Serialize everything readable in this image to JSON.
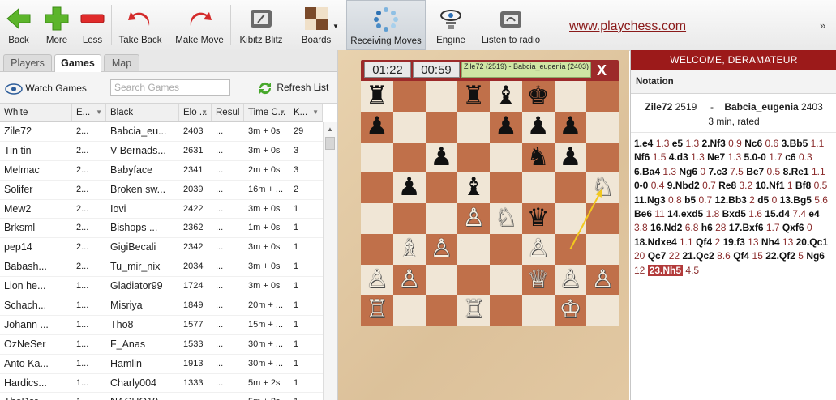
{
  "toolbar": {
    "back": "Back",
    "more": "More",
    "less": "Less",
    "take_back": "Take Back",
    "make_move": "Make Move",
    "kibitz_blitz": "Kibitz Blitz",
    "boards": "Boards",
    "receiving_moves": "Receiving Moves",
    "engine": "Engine",
    "listen_radio": "Listen to radio",
    "site_link": "www.playchess.com",
    "more_chevron": "»"
  },
  "tabs": [
    "Players",
    "Games",
    "Map"
  ],
  "active_tab": "Games",
  "subbar": {
    "watch_games": "Watch Games",
    "search_placeholder": "Search Games",
    "refresh_list": "Refresh List"
  },
  "columns": [
    "White",
    "E...",
    "Black",
    "Elo ...",
    "Resul",
    "Time C...",
    "K..."
  ],
  "games": [
    [
      "Zile72",
      "2...",
      "Babcia_eu...",
      "2403",
      "...",
      "3m + 0s",
      "29"
    ],
    [
      "Tin tin",
      "2...",
      "V-Bernads...",
      "2631",
      "...",
      "3m + 0s",
      "3"
    ],
    [
      "Melmac",
      "2...",
      "Babyface",
      "2341",
      "...",
      "2m + 0s",
      "3"
    ],
    [
      "Solifer",
      "2...",
      "Broken sw...",
      "2039",
      "...",
      "16m + ...",
      "2"
    ],
    [
      "Mew2",
      "2...",
      "Iovi",
      "2422",
      "...",
      "3m + 0s",
      "1"
    ],
    [
      "Brksml",
      "2...",
      "Bishops ...",
      "2362",
      "...",
      "1m + 0s",
      "1"
    ],
    [
      "pep14",
      "2...",
      "GigiBecali",
      "2342",
      "...",
      "3m + 0s",
      "1"
    ],
    [
      "Babash...",
      "2...",
      "Tu_mir_nix",
      "2034",
      "...",
      "3m + 0s",
      "1"
    ],
    [
      "Lion he...",
      "1...",
      "Gladiator99",
      "1724",
      "...",
      "3m + 0s",
      "1"
    ],
    [
      "Schach...",
      "1...",
      "Misriya",
      "1849",
      "...",
      "20m + ...",
      "1"
    ],
    [
      "Johann ...",
      "1...",
      "Tho8",
      "1577",
      "...",
      "15m + ...",
      "1"
    ],
    [
      "OzNeSer",
      "1...",
      "F_Anas",
      "1533",
      "...",
      "30m + ...",
      "1"
    ],
    [
      "Anto Ka...",
      "1...",
      "Hamlin",
      "1913",
      "...",
      "30m + ...",
      "1"
    ],
    [
      "Hardics...",
      "1...",
      "Charly004",
      "1333",
      "...",
      "5m + 2s",
      "1"
    ],
    [
      "TheDar...",
      "1...",
      "NACHO19...",
      "",
      "...",
      "5m + 2s",
      "1"
    ]
  ],
  "board": {
    "clock_left": "01:22",
    "clock_right": "00:59",
    "players": "Zile72 (2519) - Babcia_eugenia (2403)",
    "close": "X",
    "pieces": [
      {
        "sq": "a8",
        "p": "♜",
        "c": "b"
      },
      {
        "sq": "d8",
        "p": "♜",
        "c": "b"
      },
      {
        "sq": "e8",
        "p": "♝",
        "c": "b"
      },
      {
        "sq": "f8",
        "p": "♚",
        "c": "b"
      },
      {
        "sq": "a7",
        "p": "♟",
        "c": "b"
      },
      {
        "sq": "e7",
        "p": "♟",
        "c": "b"
      },
      {
        "sq": "f7",
        "p": "♟",
        "c": "b"
      },
      {
        "sq": "g7",
        "p": "♟",
        "c": "b"
      },
      {
        "sq": "c6",
        "p": "♟",
        "c": "b"
      },
      {
        "sq": "f6",
        "p": "♞",
        "c": "b"
      },
      {
        "sq": "g6",
        "p": "♟",
        "c": "b"
      },
      {
        "sq": "b5",
        "p": "♟",
        "c": "b"
      },
      {
        "sq": "d5",
        "p": "♝",
        "c": "b"
      },
      {
        "sq": "h5",
        "p": "♘",
        "c": "w"
      },
      {
        "sq": "d4",
        "p": "♙",
        "c": "w"
      },
      {
        "sq": "e4",
        "p": "♘",
        "c": "w"
      },
      {
        "sq": "f4",
        "p": "♛",
        "c": "b"
      },
      {
        "sq": "b3",
        "p": "♗",
        "c": "w"
      },
      {
        "sq": "c3",
        "p": "♙",
        "c": "w"
      },
      {
        "sq": "f3",
        "p": "♙",
        "c": "w"
      },
      {
        "sq": "a2",
        "p": "♙",
        "c": "w"
      },
      {
        "sq": "b2",
        "p": "♙",
        "c": "w"
      },
      {
        "sq": "f2",
        "p": "♕",
        "c": "w"
      },
      {
        "sq": "g2",
        "p": "♙",
        "c": "w"
      },
      {
        "sq": "h2",
        "p": "♙",
        "c": "w"
      },
      {
        "sq": "a1",
        "p": "♖",
        "c": "w"
      },
      {
        "sq": "d1",
        "p": "♖",
        "c": "w"
      },
      {
        "sq": "g1",
        "p": "♔",
        "c": "w"
      }
    ],
    "last_move_from": "g3",
    "last_move_to": "h5"
  },
  "right": {
    "welcome": "WELCOME, DERAMATEUR",
    "notation": "Notation",
    "white": "Zile72",
    "white_elo": "2519",
    "dash": "-",
    "black": "Babcia_eugenia",
    "black_elo": "2403",
    "time_control": "3 min, rated",
    "moves": [
      [
        "1.e4",
        "1.3"
      ],
      [
        "e5",
        "1.3"
      ],
      [
        "2.Nf3",
        "0.9"
      ],
      [
        "Nc6",
        "0.6"
      ],
      [
        "3.Bb5",
        "1.1"
      ],
      [
        "Nf6",
        "1.5"
      ],
      [
        "4.d3",
        "1.3"
      ],
      [
        "Ne7",
        "1.3"
      ],
      [
        "5.0-0",
        "1.7"
      ],
      [
        "c6",
        "0.3"
      ],
      [
        "6.Ba4",
        "1.3"
      ],
      [
        "Ng6",
        "0"
      ],
      [
        "7.c3",
        "7.5"
      ],
      [
        "Be7",
        "0.5"
      ],
      [
        "8.Re1",
        "1.1"
      ],
      [
        "0-0",
        "0.4"
      ],
      [
        "9.Nbd2",
        "0.7"
      ],
      [
        "Re8",
        "3.2"
      ],
      [
        "10.Nf1",
        "1"
      ],
      [
        "Bf8",
        "0.5"
      ],
      [
        "11.Ng3",
        "0.8"
      ],
      [
        "b5",
        "0.7"
      ],
      [
        "12.Bb3",
        "2"
      ],
      [
        "d5",
        "0"
      ],
      [
        "13.Bg5",
        "5.6"
      ],
      [
        "Be6",
        "11"
      ],
      [
        "14.exd5",
        "1.8"
      ],
      [
        "Bxd5",
        "1.6"
      ],
      [
        "15.d4",
        "7.4"
      ],
      [
        "e4",
        "3.8"
      ],
      [
        "16.Nd2",
        "6.8"
      ],
      [
        "h6",
        "28"
      ],
      [
        "17.Bxf6",
        "1.7"
      ],
      [
        "Qxf6",
        "0"
      ],
      [
        "18.Ndxe4",
        "1.1"
      ],
      [
        "Qf4",
        "2"
      ],
      [
        "19.f3",
        "13"
      ],
      [
        "Nh4",
        "13"
      ],
      [
        "20.Qc1",
        "20"
      ],
      [
        "Qc7",
        "22"
      ],
      [
        "21.Qc2",
        "8.6"
      ],
      [
        "Qf4",
        "15"
      ],
      [
        "22.Qf2",
        "5"
      ],
      [
        "Ng6",
        "12"
      ],
      [
        "23.Nh5",
        "4.5"
      ]
    ],
    "highlight_index": 44
  }
}
